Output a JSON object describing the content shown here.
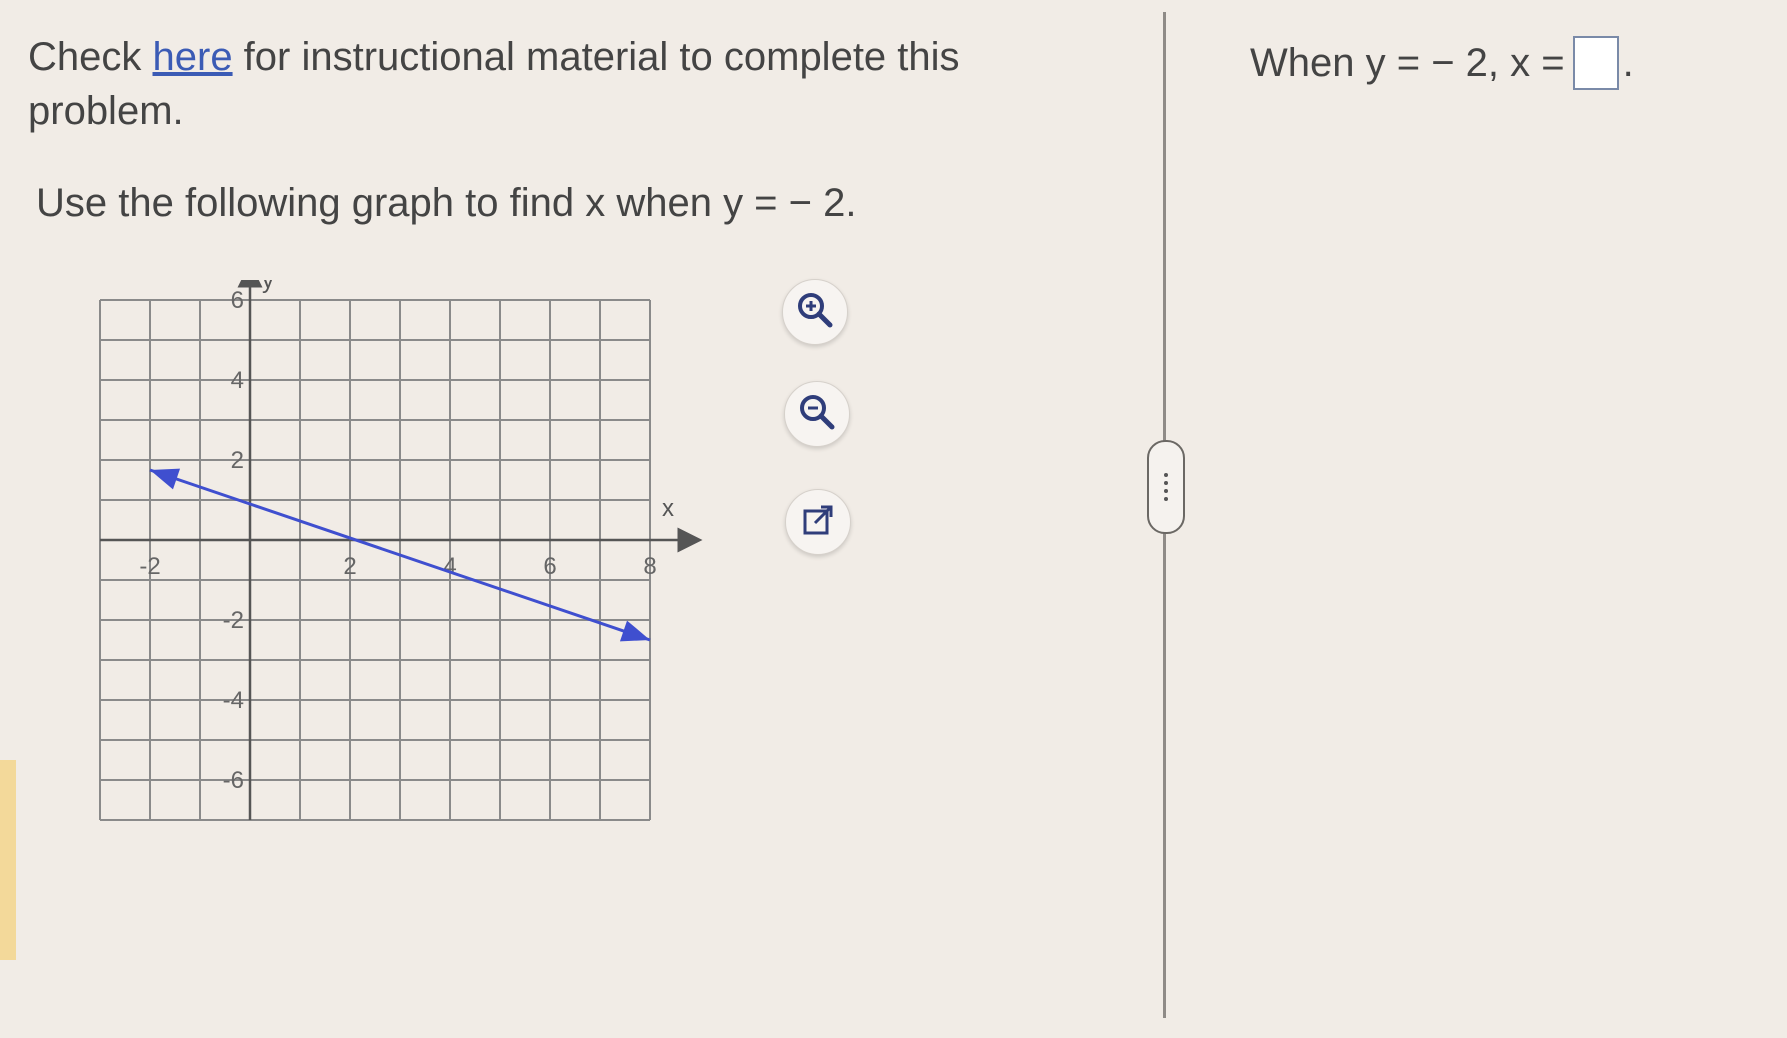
{
  "instruction": {
    "prefix": "Check ",
    "link": "here",
    "suffix": " for instructional material to complete this problem."
  },
  "question": "Use the following graph to find x when y = − 2.",
  "graph": {
    "x_axis_label": "x",
    "y_axis_label": "y",
    "x_ticks": [
      "-2",
      "2",
      "4",
      "6",
      "8"
    ],
    "y_ticks": [
      "6",
      "4",
      "2",
      "-2",
      "-4",
      "-6"
    ],
    "line_color": "#3f4fcf",
    "line_points": [
      [
        -2,
        1.75
      ],
      [
        8,
        -2.5
      ]
    ]
  },
  "tools": {
    "zoom_in": "zoom-in-icon",
    "zoom_out": "zoom-out-icon",
    "popout": "popout-icon"
  },
  "answer": {
    "prefix": "When y = − 2, x =",
    "suffix": ".",
    "value": ""
  },
  "colors": {
    "link": "#3b5bb5",
    "background": "#f1ece6",
    "grid": "#8a8a8a"
  }
}
